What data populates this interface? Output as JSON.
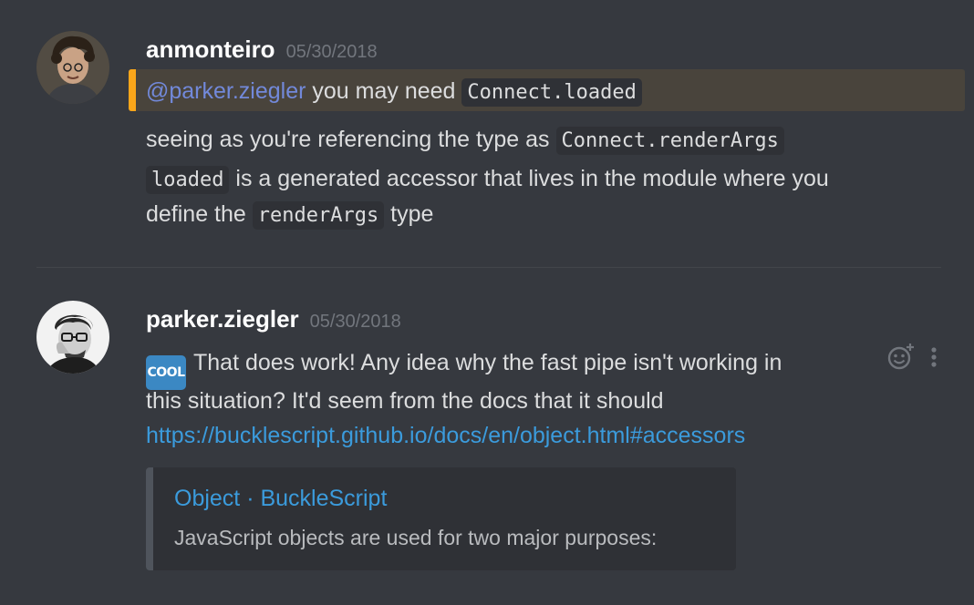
{
  "messages": [
    {
      "author": "anmonteiro",
      "timestamp": "05/30/2018",
      "avatar_icon": "user-avatar-curly-hair",
      "mention_line": {
        "mention": "@parker.ziegler",
        "text": " you may need ",
        "code": "Connect.loaded"
      },
      "line2": {
        "text": "seeing as you're referencing the type as ",
        "code": "Connect.renderArgs"
      },
      "line3": {
        "code": "loaded",
        "text": " is a generated accessor that lives in the module where you"
      },
      "line4": {
        "text": "define the ",
        "code": "renderArgs",
        "text_after": " type"
      }
    },
    {
      "author": "parker.ziegler",
      "timestamp": "05/30/2018",
      "avatar_icon": "user-avatar-glasses",
      "emoji": {
        "name": "cool-emoji-icon",
        "label": "COOL"
      },
      "line1": "That does work! Any idea why the fast pipe isn't working in",
      "line2": "this situation? It'd seem from the docs that it should",
      "link": "https://bucklescript.github.io/docs/en/object.html#accessors",
      "embed": {
        "title": "Object · BuckleScript",
        "description": "JavaScript objects are used for two major purposes:"
      },
      "actions": [
        "add-reaction-icon",
        "more-options-icon"
      ]
    }
  ],
  "colors": {
    "background": "#36393f",
    "mention_highlight": "#49443c",
    "mention_accent": "#faa61a",
    "mention_text": "#7289da",
    "link": "#3b9bdc",
    "embed_bg": "#2f3136"
  }
}
